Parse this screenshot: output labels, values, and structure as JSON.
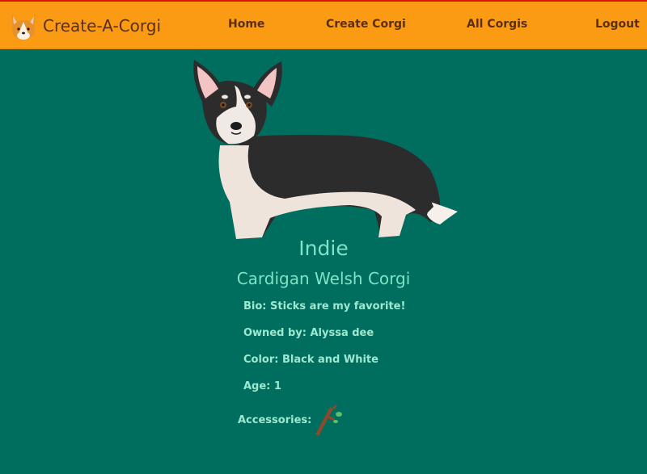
{
  "navbar": {
    "brand": "Create-A-Corgi",
    "links": [
      "Home",
      "Create Corgi",
      "All Corgis",
      "Logout"
    ]
  },
  "corgi": {
    "name": "Indie",
    "breed": "Cardigan Welsh Corgi",
    "bio_label": "Bio:",
    "bio": "Sticks are my favorite!",
    "owner_label": "Owned by:",
    "owner": "Alyssa dee",
    "color_label": "Color:",
    "color": "Black and White",
    "age_label": "Age:",
    "age": "1",
    "accessories_label": "Accessories:",
    "accessories": [
      "stick-icon"
    ]
  },
  "colors": {
    "navbar": "#fb9b14",
    "background": "#006e5f",
    "accent_text": "#7fe3c5",
    "nav_text": "#5a2f15"
  }
}
